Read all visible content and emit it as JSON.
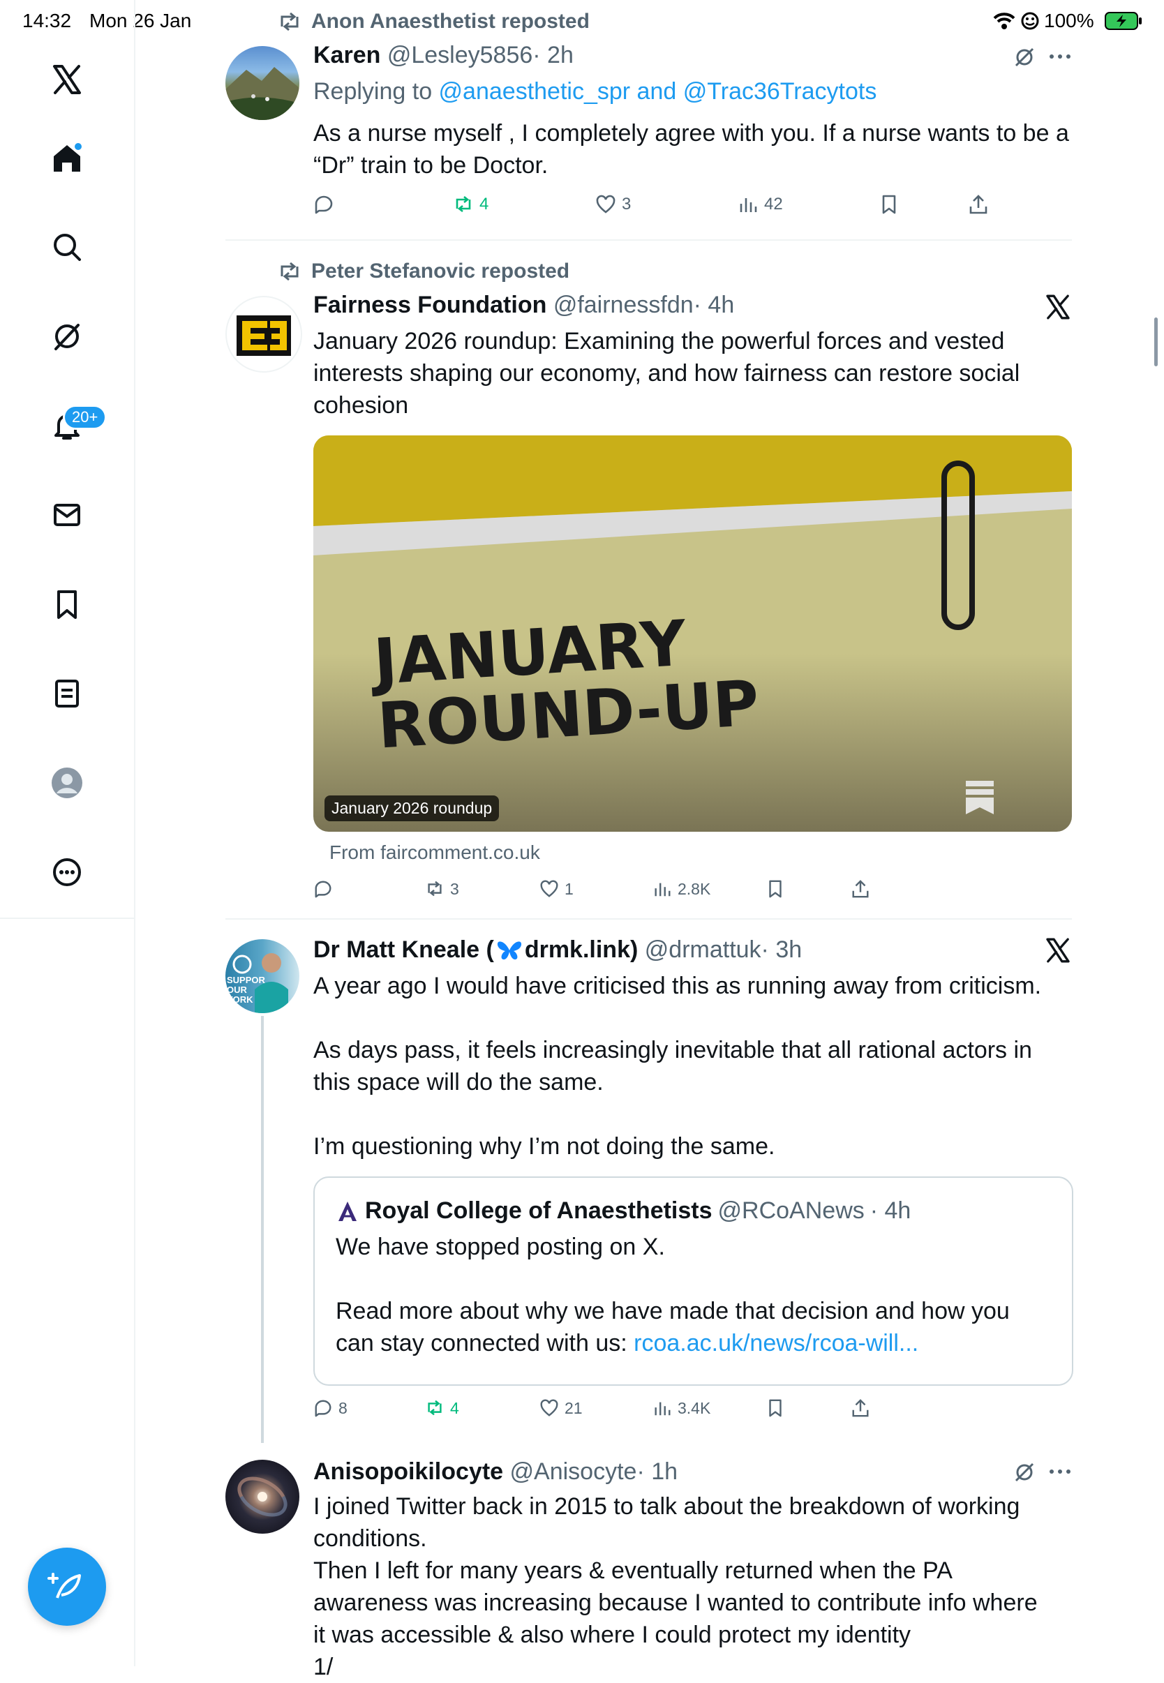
{
  "status_bar": {
    "time": "14:32",
    "date": "Mon 26 Jan",
    "battery": "100%"
  },
  "sidebar": {
    "items": [
      {
        "name": "x-logo-icon"
      },
      {
        "name": "home-icon"
      },
      {
        "name": "search-icon"
      },
      {
        "name": "grok-icon"
      },
      {
        "name": "notifications-icon"
      },
      {
        "name": "messages-icon"
      },
      {
        "name": "bookmarks-icon"
      },
      {
        "name": "lists-icon"
      },
      {
        "name": "profile-icon"
      },
      {
        "name": "more-icon"
      }
    ],
    "notifications_badge": "20+"
  },
  "feed": {
    "post1": {
      "repost_label": "Anon Anaesthetist reposted",
      "name": "Karen",
      "handle": "@Lesley5856",
      "time": "· 2h",
      "replying_prefix": "Replying to ",
      "replying_to": "@anaesthetic_spr and @Trac36Tracytots",
      "text_line1": "As a nurse myself , I completely agree with you. If a nurse wants to be a",
      "text_line2": "“Dr” train to be  Doctor.",
      "reposts": "4",
      "likes": "3",
      "views": "42"
    },
    "post2": {
      "repost_label": "Peter Stefanovic reposted",
      "name": "Fairness Foundation",
      "handle": "@fairnessfdn",
      "time": "· 4h",
      "text_line1": "January 2026 roundup: Examining the powerful forces and vested",
      "text_line2": "interests shaping our economy, and how fairness can restore social",
      "text_line3": "cohesion",
      "card_title_line1": "JANUARY",
      "card_title_line2": "ROUND-UP",
      "card_caption": "January 2026 roundup",
      "card_source": "From faircomment.co.uk",
      "reposts": "3",
      "likes": "1",
      "views": "2.8K"
    },
    "post3": {
      "name": "Dr Matt Kneale (",
      "name_suffix": "drmk.link)",
      "handle": "@drmattuk",
      "time": "· 3h",
      "text_line1": "A year ago I would have criticised this as running away from criticism.",
      "text_line2": "As days pass, it feels increasingly inevitable that all rational actors in",
      "text_line3": "this space will do the same.",
      "text_line4": "I’m questioning why I’m not doing the same.",
      "avatar_text1": "SUPPOR",
      "avatar_text2": "OUR",
      "avatar_text3": "VORK",
      "quote": {
        "name": "Royal College of Anaesthetists",
        "handle": "@RCoANews",
        "time": "· 4h",
        "text_line1": "We have stopped posting on X.",
        "text_line2": "Read more about why we have made that decision and how you",
        "text_line3_prefix": "can stay connected with us: ",
        "link": "rcoa.ac.uk/news/rcoa-will..."
      },
      "replies": "8",
      "reposts": "4",
      "likes": "21",
      "views": "3.4K"
    },
    "post4": {
      "name": "Anisopoikilocyte",
      "handle": "@Anisocyte",
      "time": "· 1h",
      "text_line1": "I joined Twitter back in 2015 to talk about the breakdown of working",
      "text_line2": "conditions.",
      "text_line3": "Then I left for many years & eventually returned when the PA",
      "text_line4": "awareness was increasing because I wanted to contribute info where",
      "text_line5": "it was accessible & also where I could protect my identity",
      "text_line6": "1/"
    }
  }
}
